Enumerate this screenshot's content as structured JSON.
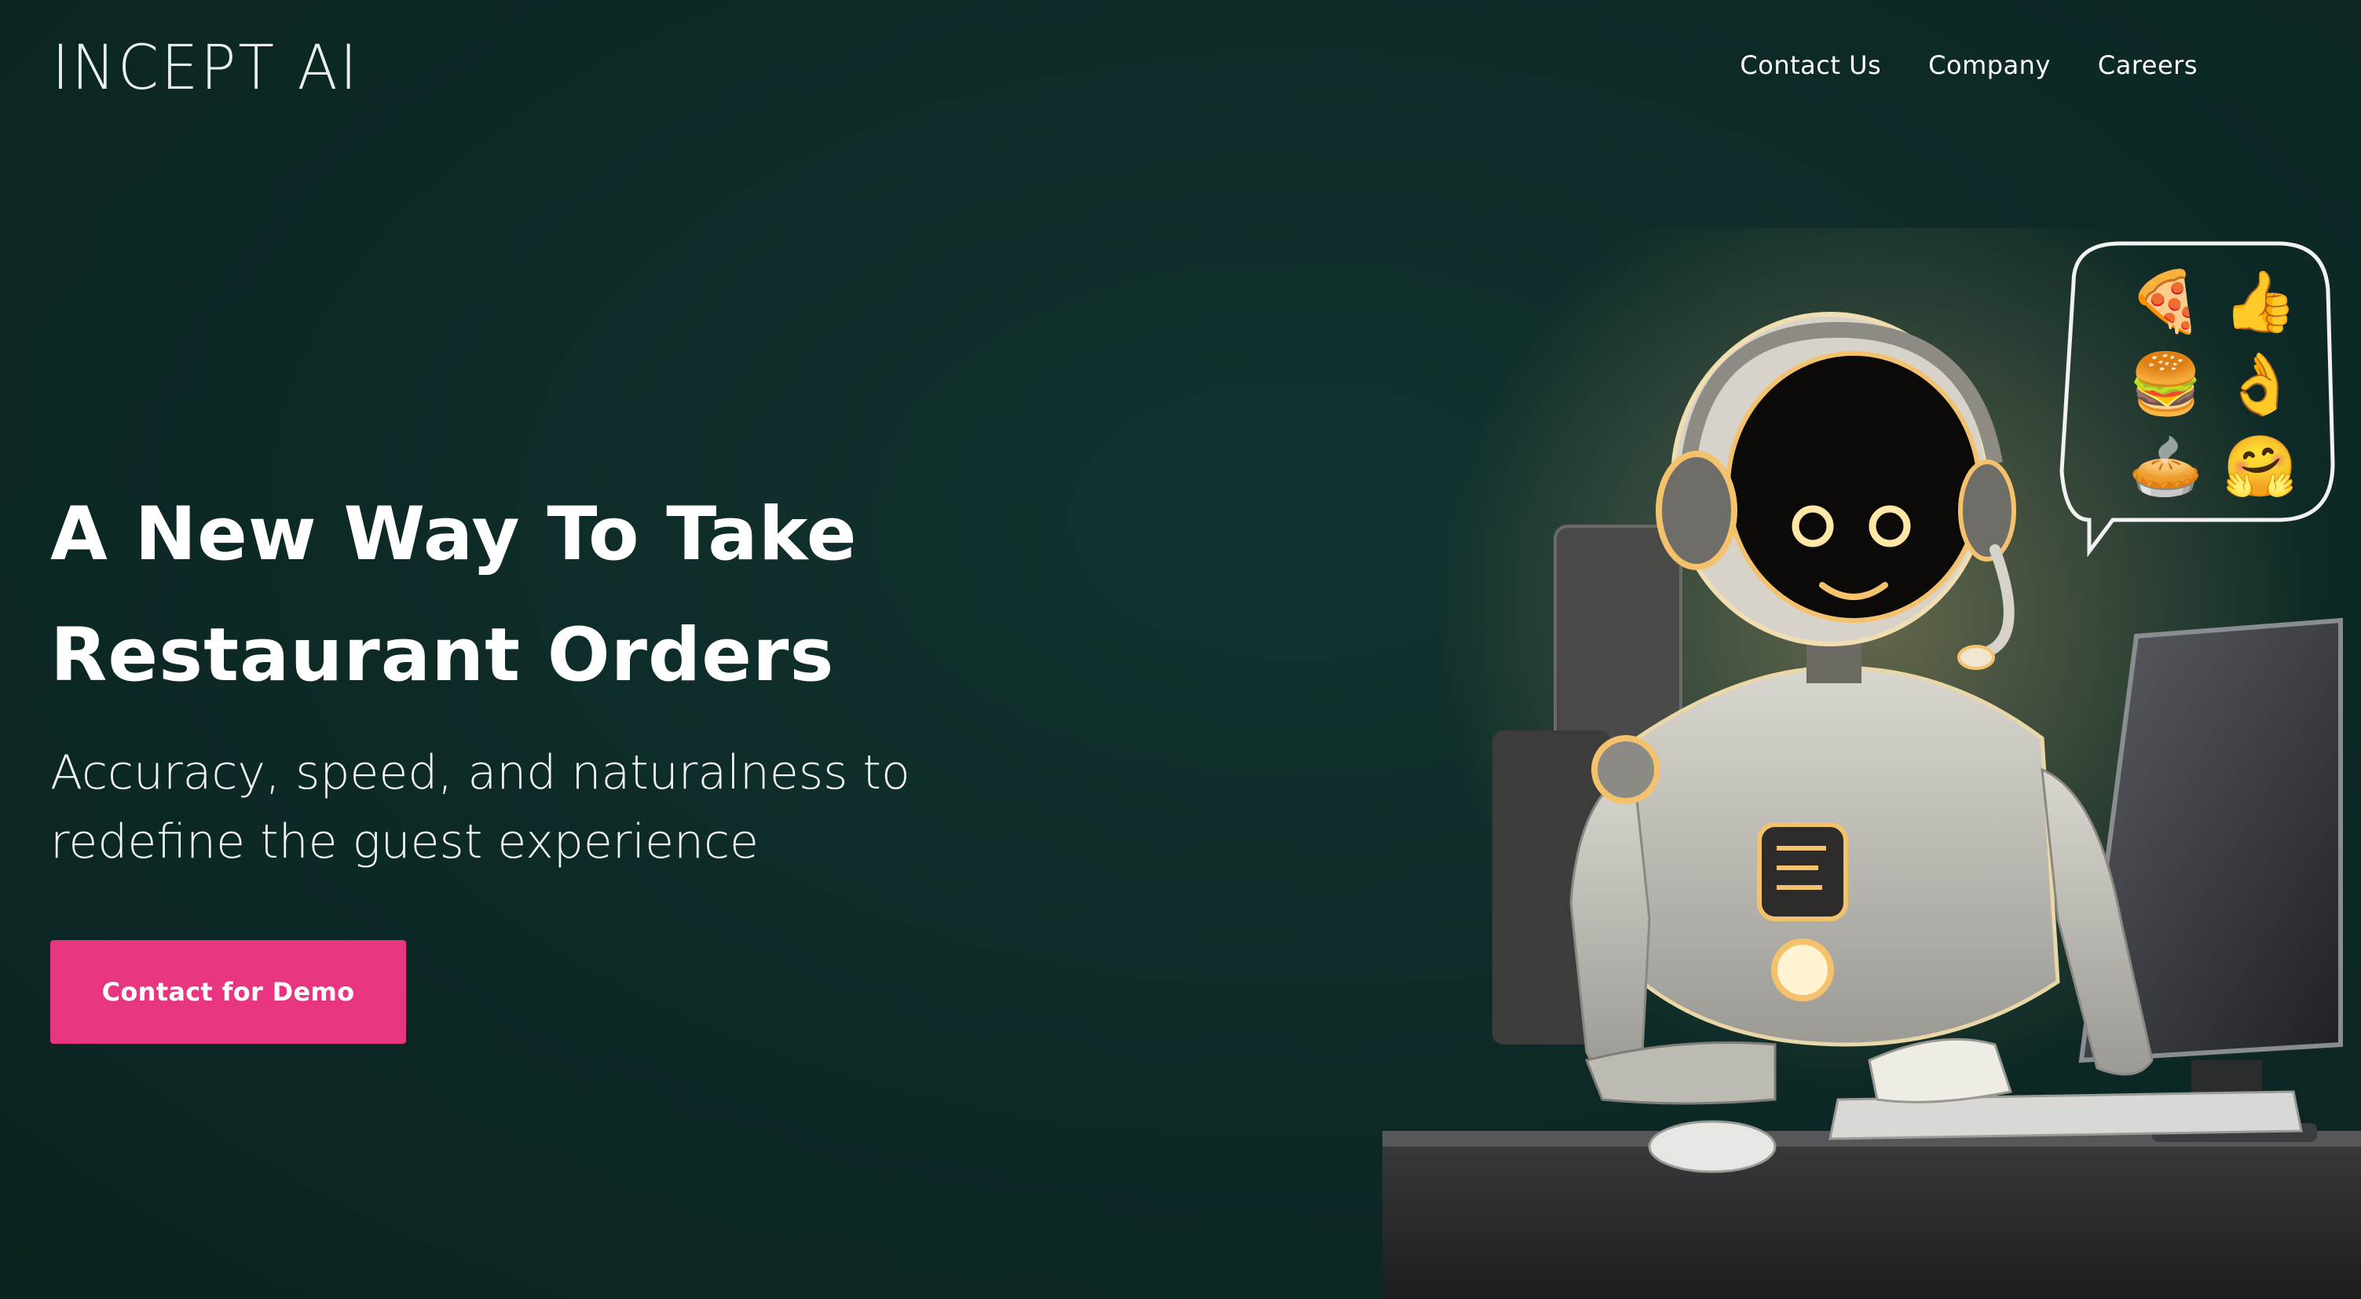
{
  "brand": {
    "logo_text": "INCEPT AI"
  },
  "nav": {
    "items": [
      {
        "label": "Contact Us"
      },
      {
        "label": "Company"
      },
      {
        "label": "Careers"
      }
    ]
  },
  "hero": {
    "title_line1": "A New Way To Take",
    "title_line2": "Restaurant Orders",
    "subtitle_line1": "Accuracy, speed, and naturalness to",
    "subtitle_line2": "redefine the guest experience",
    "cta_label": "Contact for Demo",
    "illustration_icons": [
      "robot",
      "headset",
      "computer-monitor",
      "keyboard",
      "mouse",
      "desk",
      "chair",
      "speech-bubble",
      "pizza-icon",
      "thumbs-up-icon",
      "burger-icon",
      "ok-hand-icon",
      "pie-icon",
      "hugging-face-icon"
    ]
  },
  "colors": {
    "background": "#0e2b28",
    "accent": "#e8357f",
    "text": "#ffffff"
  }
}
